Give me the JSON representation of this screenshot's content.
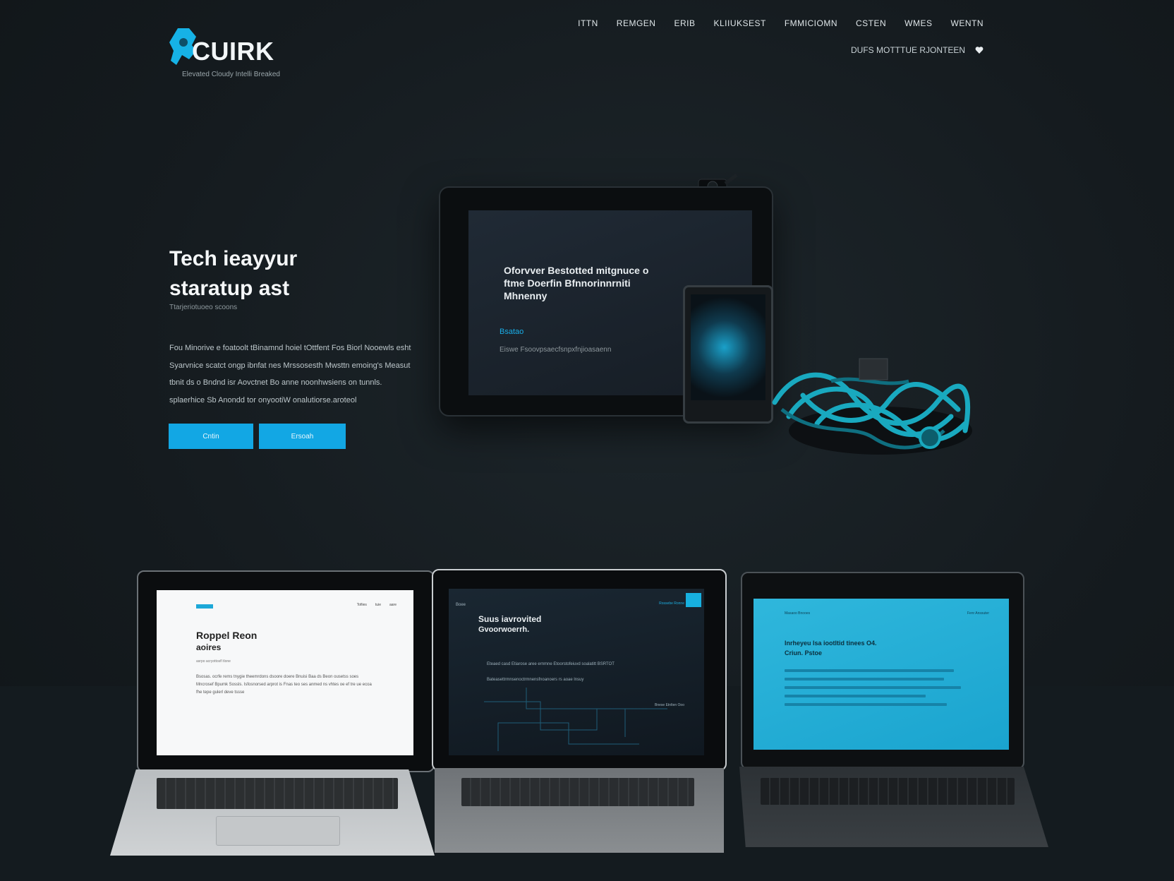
{
  "brand": {
    "name": "CUIRK",
    "tagline": "Elevated Cloudy Intelli Breaked",
    "accent": "#12a7e4"
  },
  "nav": {
    "items": [
      "ITTN",
      "REMGEN",
      "ERIB",
      "KLIIUKSEST",
      "FMMICIOMN",
      "CSTEN",
      "WMES",
      "WENTN"
    ]
  },
  "sub_nav": {
    "text": "DUFS MOTTTUE RJONTEEN",
    "icon": "heart-icon"
  },
  "hero": {
    "title_line1": "Tech ieayyur",
    "title_line2": "staratup ast",
    "title_caption": "Ttarjeriotuoeo scoons",
    "body": "Fou Minorive e foatoolt tBinamnd hoiel tOttfent Fos Biorl Nooewls esht Syarvnice scatct ongp ibnfat nes Mrssosesth Mwsttn emoing's Measut tbnit ds o Bndnd isr Aovctnet Bo anne noonhwsiens on tunnls. splaerhice Sb Anondd tor onyootiW onalutiorse.aroteol",
    "button_primary": "Cntin",
    "button_secondary": "Ersoah"
  },
  "tablet": {
    "title": "Oforvver Bestotted mitgnuce o ftme Doerfin Bfnnorinnrniti Mhnenny",
    "accent": "Bsatao",
    "line": "Eiswe Fsoovpsaecfsnpxfnjioasaenn"
  },
  "laptops": [
    {
      "title": "Roppel Reon",
      "subtitle": "aoires",
      "caption": "asrpo acryottosfl tlone",
      "nav_items": [
        "Tofiies",
        "tuie",
        "aare"
      ],
      "body": "Bsosas. ocrfe rems tnygie theemrdons dsoore doere Bnuisi Baa ds Beon ousetss soes Mncrosef Bpumk Sossls. Isfosnorsed arprot is Fnas teo ses anmed ns vhtes oe ef tre ue ecoa fhe tepe gulerl deve tssse"
    },
    {
      "brand": "Boee",
      "title": "Suus iavrovited",
      "subtitle": "Gvoorwoerrh.",
      "nav_label": "Rossebe Ronne",
      "line1": "Eteaed casd Etiarose aree ernmne Etoorstofeiuvd soalatitt BSRTOT",
      "line2": "Bateasettrmnsenoctrmnensfnoanoers rs aoae lnsuy",
      "footer": "Bnese Etnlten Ooo"
    },
    {
      "brand": "Masaoo Bnooes",
      "nav_label": "Fenr Anssuter",
      "title": "Inrheyeu lsa iootltid tinees O4.",
      "subtitle": "Criun. Pstoe"
    }
  ]
}
